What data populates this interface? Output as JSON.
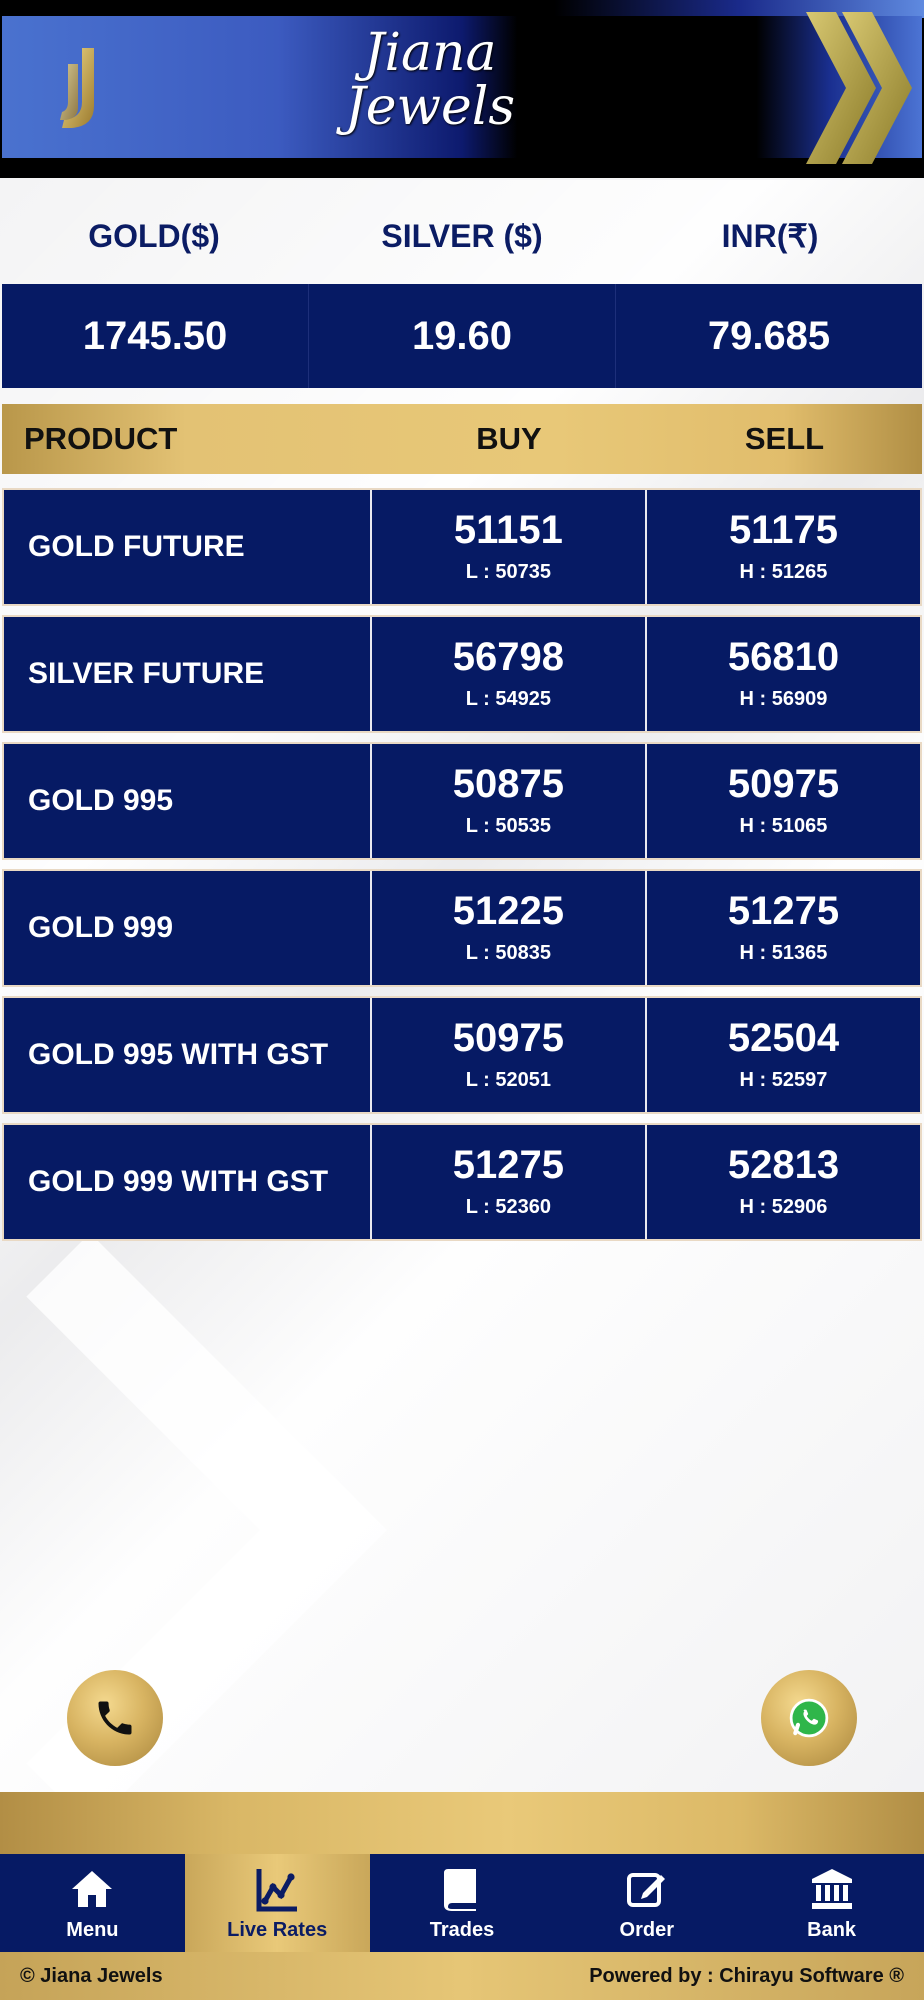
{
  "header": {
    "brand_line1": "Jiana",
    "brand_line2": "Jewels"
  },
  "rates": {
    "labels": [
      "GOLD($)",
      "SILVER ($)",
      "INR(₹)"
    ],
    "values": [
      "1745.50",
      "19.60",
      "79.685"
    ]
  },
  "table": {
    "headers": {
      "product": "PRODUCT",
      "buy": "BUY",
      "sell": "SELL"
    },
    "rows": [
      {
        "name": "GOLD FUTURE",
        "buy": "51151",
        "low": "L : 50735",
        "sell": "51175",
        "high": "H : 51265"
      },
      {
        "name": "SILVER FUTURE",
        "buy": "56798",
        "low": "L : 54925",
        "sell": "56810",
        "high": "H : 56909"
      },
      {
        "name": "GOLD 995",
        "buy": "50875",
        "low": "L : 50535",
        "sell": "50975",
        "high": "H : 51065"
      },
      {
        "name": "GOLD 999",
        "buy": "51225",
        "low": "L : 50835",
        "sell": "51275",
        "high": "H : 51365"
      },
      {
        "name": "GOLD 995 WITH GST",
        "buy": "50975",
        "low": "L : 52051",
        "sell": "52504",
        "high": "H : 52597"
      },
      {
        "name": "GOLD 999 WITH GST",
        "buy": "51275",
        "low": "L : 52360",
        "sell": "52813",
        "high": "H : 52906"
      }
    ]
  },
  "fabs": {
    "call_icon": "phone-icon",
    "whatsapp_icon": "whatsapp-icon"
  },
  "nav": {
    "items": [
      {
        "label": "Menu",
        "icon": "home-icon"
      },
      {
        "label": "Live Rates",
        "icon": "chart-icon"
      },
      {
        "label": "Trades",
        "icon": "book-icon"
      },
      {
        "label": "Order",
        "icon": "edit-icon"
      },
      {
        "label": "Bank",
        "icon": "bank-icon"
      }
    ],
    "active_index": 1
  },
  "footer": {
    "copyright": "© Jiana Jewels",
    "powered": "Powered by : Chirayu Software ®"
  },
  "colors": {
    "navy": "#061a64",
    "gold": "#e3c274",
    "header_blue": "#4a72cf"
  }
}
